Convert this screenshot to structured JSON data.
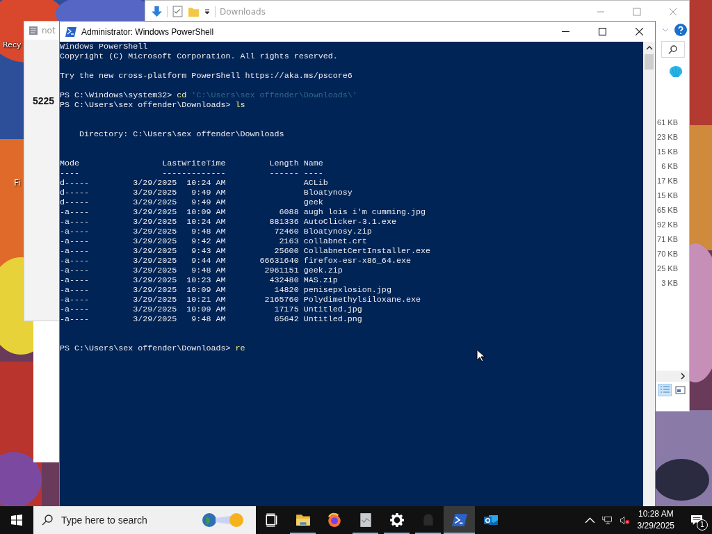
{
  "desktop": {
    "icon_labels": [
      "Recy",
      "Fi"
    ]
  },
  "notepad_window": {
    "title": "not",
    "text": "5225"
  },
  "explorer_window": {
    "title": "Downloads",
    "sizes": [
      "61 KB",
      "23 KB",
      "15 KB",
      "6 KB",
      "17 KB",
      "15 KB",
      "65 KB",
      "92 KB",
      "71 KB",
      "70 KB",
      "25 KB",
      "3 KB"
    ]
  },
  "powershell_window": {
    "title": "Administrator: Windows PowerShell",
    "before": [
      {
        "kind": "text",
        "segments": [
          {
            "kind": "plain",
            "text": "Windows PowerShell"
          }
        ]
      },
      {
        "kind": "text",
        "segments": [
          {
            "kind": "plain",
            "text": "Copyright (C) Microsoft Corporation. All rights reserved."
          }
        ]
      },
      {
        "kind": "blank"
      },
      {
        "kind": "text",
        "segments": [
          {
            "kind": "plain",
            "text": "Try the new cross-platform PowerShell https://aka.ms/pscore6"
          }
        ]
      },
      {
        "kind": "blank"
      },
      {
        "kind": "text",
        "segments": [
          {
            "kind": "plain",
            "text": "PS C:\\Windows\\system32> "
          },
          {
            "kind": "command",
            "text": "cd"
          },
          {
            "kind": "string",
            "text": " 'C:\\Users\\sex offender\\Downloads\\'"
          }
        ]
      },
      {
        "kind": "text",
        "segments": [
          {
            "kind": "plain",
            "text": "PS C:\\Users\\sex offender\\Downloads> "
          },
          {
            "kind": "command",
            "text": "ls"
          }
        ]
      },
      {
        "kind": "blank"
      },
      {
        "kind": "blank"
      },
      {
        "kind": "text",
        "segments": [
          {
            "kind": "plain",
            "text": "    Directory: C:\\Users\\sex offender\\Downloads"
          }
        ]
      },
      {
        "kind": "blank"
      },
      {
        "kind": "blank"
      }
    ],
    "listing": {
      "columns": [
        {
          "label": "Mode",
          "rule": "----"
        },
        {
          "label": "LastWriteTime",
          "rule": "-------------"
        },
        {
          "label": "Length",
          "rule": "------"
        },
        {
          "label": "Name",
          "rule": "----"
        }
      ],
      "rows": [
        {
          "mode": "d-----",
          "last_write_time": "3/29/2025  10:24 AM",
          "name": "ACLib"
        },
        {
          "mode": "d-----",
          "last_write_time": "3/29/2025   9:49 AM",
          "name": "Bloatynosy"
        },
        {
          "mode": "d-----",
          "last_write_time": "3/29/2025   9:49 AM",
          "name": "geek"
        },
        {
          "mode": "-a----",
          "last_write_time": "3/29/2025  10:09 AM",
          "length": "6088",
          "name": "augh lois i'm cumming.jpg"
        },
        {
          "mode": "-a----",
          "last_write_time": "3/29/2025  10:24 AM",
          "length": "881336",
          "name": "AutoClicker-3.1.exe"
        },
        {
          "mode": "-a----",
          "last_write_time": "3/29/2025   9:48 AM",
          "length": "72460",
          "name": "Bloatynosy.zip"
        },
        {
          "mode": "-a----",
          "last_write_time": "3/29/2025   9:42 AM",
          "length": "2163",
          "name": "collabnet.crt"
        },
        {
          "mode": "-a----",
          "last_write_time": "3/29/2025   9:43 AM",
          "length": "25600",
          "name": "CollabnetCertInstaller.exe"
        },
        {
          "mode": "-a----",
          "last_write_time": "3/29/2025   9:44 AM",
          "length": "66631640",
          "name": "firefox-esr-x86_64.exe"
        },
        {
          "mode": "-a----",
          "last_write_time": "3/29/2025   9:48 AM",
          "length": "2961151",
          "name": "geek.zip"
        },
        {
          "mode": "-a----",
          "last_write_time": "3/29/2025  10:23 AM",
          "length": "432480",
          "name": "MAS.zip"
        },
        {
          "mode": "-a----",
          "last_write_time": "3/29/2025  10:09 AM",
          "length": "14820",
          "name": "penisepxlosion.jpg"
        },
        {
          "mode": "-a----",
          "last_write_time": "3/29/2025  10:21 AM",
          "length": "2165760",
          "name": "Polydimethylsiloxane.exe"
        },
        {
          "mode": "-a----",
          "last_write_time": "3/29/2025  10:09 AM",
          "length": "17175",
          "name": "Untitled.jpg"
        },
        {
          "mode": "-a----",
          "last_write_time": "3/29/2025   9:48 AM",
          "length": "65642",
          "name": "Untitled.png"
        }
      ]
    },
    "after": [
      {
        "kind": "blank"
      },
      {
        "kind": "blank"
      },
      {
        "kind": "text",
        "segments": [
          {
            "kind": "plain",
            "text": "PS C:\\Users\\sex offender\\Downloads> "
          },
          {
            "kind": "command",
            "text": "re"
          }
        ]
      }
    ]
  },
  "taskbar": {
    "search": {
      "placeholder": "Type here to search"
    },
    "apps": [
      {
        "kind": "task_view",
        "running": false,
        "active": false
      },
      {
        "kind": "folder",
        "running": true,
        "active": false
      },
      {
        "kind": "firefox",
        "running": false,
        "active": false
      },
      {
        "kind": "document",
        "running": true,
        "active": false
      },
      {
        "kind": "settings",
        "running": true,
        "active": false
      },
      {
        "kind": "dim",
        "running": true,
        "active": false
      },
      {
        "kind": "powershell",
        "running": true,
        "active": true
      },
      {
        "kind": "outlook",
        "running": false,
        "active": false
      }
    ],
    "time": "10:28 AM",
    "date": "3/29/2025",
    "notification_count": "1"
  }
}
